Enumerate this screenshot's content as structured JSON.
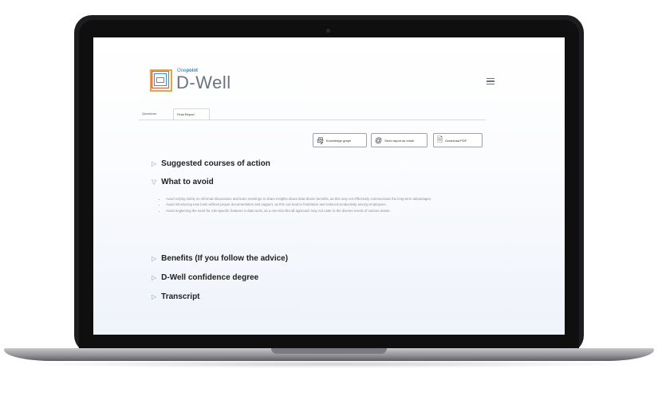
{
  "app": {
    "brand_small_a": "One",
    "brand_small_b": "point",
    "brand_name": "D-Well",
    "accent_color": "#2a7fd0"
  },
  "tabs": [
    "Questions",
    "Final Report"
  ],
  "active_tab": "Final Report",
  "actions": {
    "knowledge_graph": "Knowledge graph",
    "send_email": "Send report as email",
    "download_pdf": "Download PDF"
  },
  "sections": [
    {
      "title": "Suggested courses of action",
      "expanded": false
    },
    {
      "title": "What to avoid",
      "expanded": true
    },
    {
      "title": "Benefits (If you follow the advice)",
      "expanded": false
    },
    {
      "title": "D-Well confidence degree",
      "expanded": false
    },
    {
      "title": "Transcript",
      "expanded": false
    }
  ],
  "avoid_items": [
    "Avoid relying solely on informal discussions and team meetings to share insights about data-driven benefits, as this may not effectively communicate the long-term advantages.",
    "Avoid introducing new tools without proper documentation and support, as this can lead to frustration and reduced productivity among employees.",
    "Avoid neglecting the need for role-specific features in data tools, as a one-size-fits-all approach may not cater to the diverse needs of various teams."
  ],
  "icons": {
    "section_collapsed": "triangle-right-icon",
    "section_expanded": "triangle-down-icon",
    "menu": "hamburger-icon",
    "knowledge_graph": "graph-icon",
    "email": "at-icon",
    "pdf": "pdf-icon"
  }
}
